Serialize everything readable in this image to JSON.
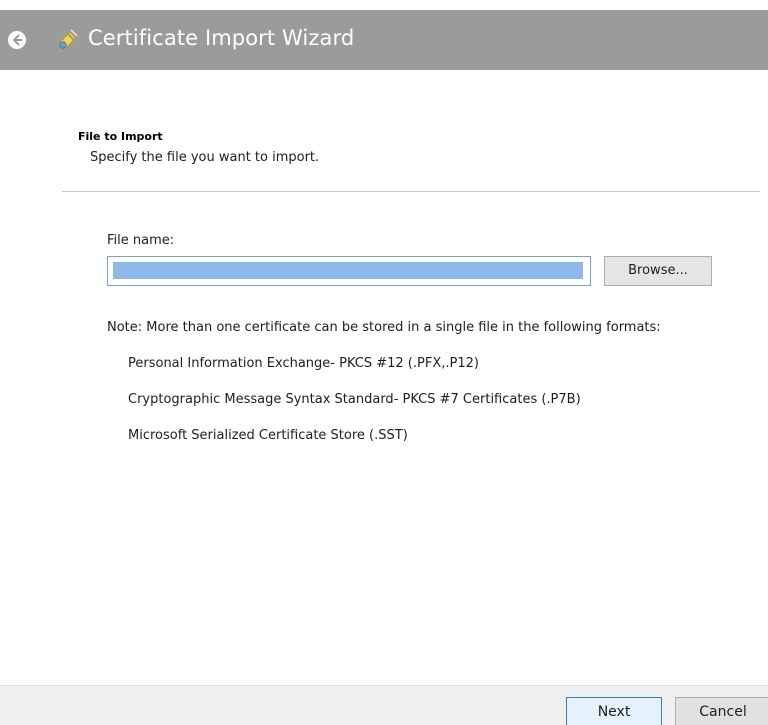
{
  "window": {
    "title": "Certificate Import Wizard",
    "back_icon": "back-arrow-icon",
    "app_icon": "certificate-icon"
  },
  "header": {
    "title": "File to Import",
    "subtitle": "Specify the file you want to import."
  },
  "file": {
    "label": "File name:",
    "value": "",
    "browse_label": "Browse..."
  },
  "note": {
    "text": "Note:  More than one certificate can be stored in a single file in the following formats:",
    "formats": [
      "Personal Information Exchange- PKCS #12 (.PFX,.P12)",
      "Cryptographic Message Syntax Standard- PKCS #7 Certificates (.P7B)",
      "Microsoft Serialized Certificate Store (.SST)"
    ]
  },
  "footer": {
    "next_label": "Next",
    "cancel_label": "Cancel"
  },
  "colors": {
    "titlebar": "#9b9b9b",
    "selection": "#8fb9ea",
    "next_border": "#3c7fb1"
  }
}
